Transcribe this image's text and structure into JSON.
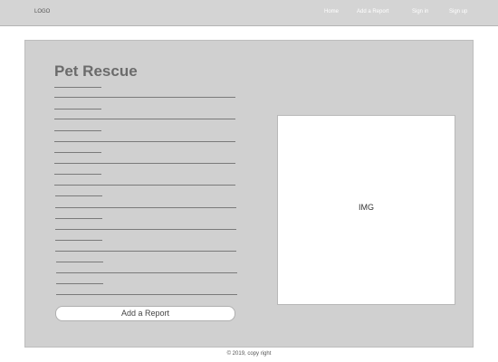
{
  "navbar": {
    "logo": "LOGO",
    "links": [
      "Home",
      "Add a Report",
      "Sign in",
      "Sign up"
    ]
  },
  "main": {
    "title": "Pet Rescue",
    "button_label": "Add a Report",
    "image_placeholder": "IMG"
  },
  "footer": {
    "text": "© 2019, copy right"
  },
  "colors": {
    "navbar_bg": "#d4d4d4",
    "panel_bg": "#d0d0d0",
    "title_text": "#6b6b6b",
    "nav_link_text": "#ffffff"
  }
}
